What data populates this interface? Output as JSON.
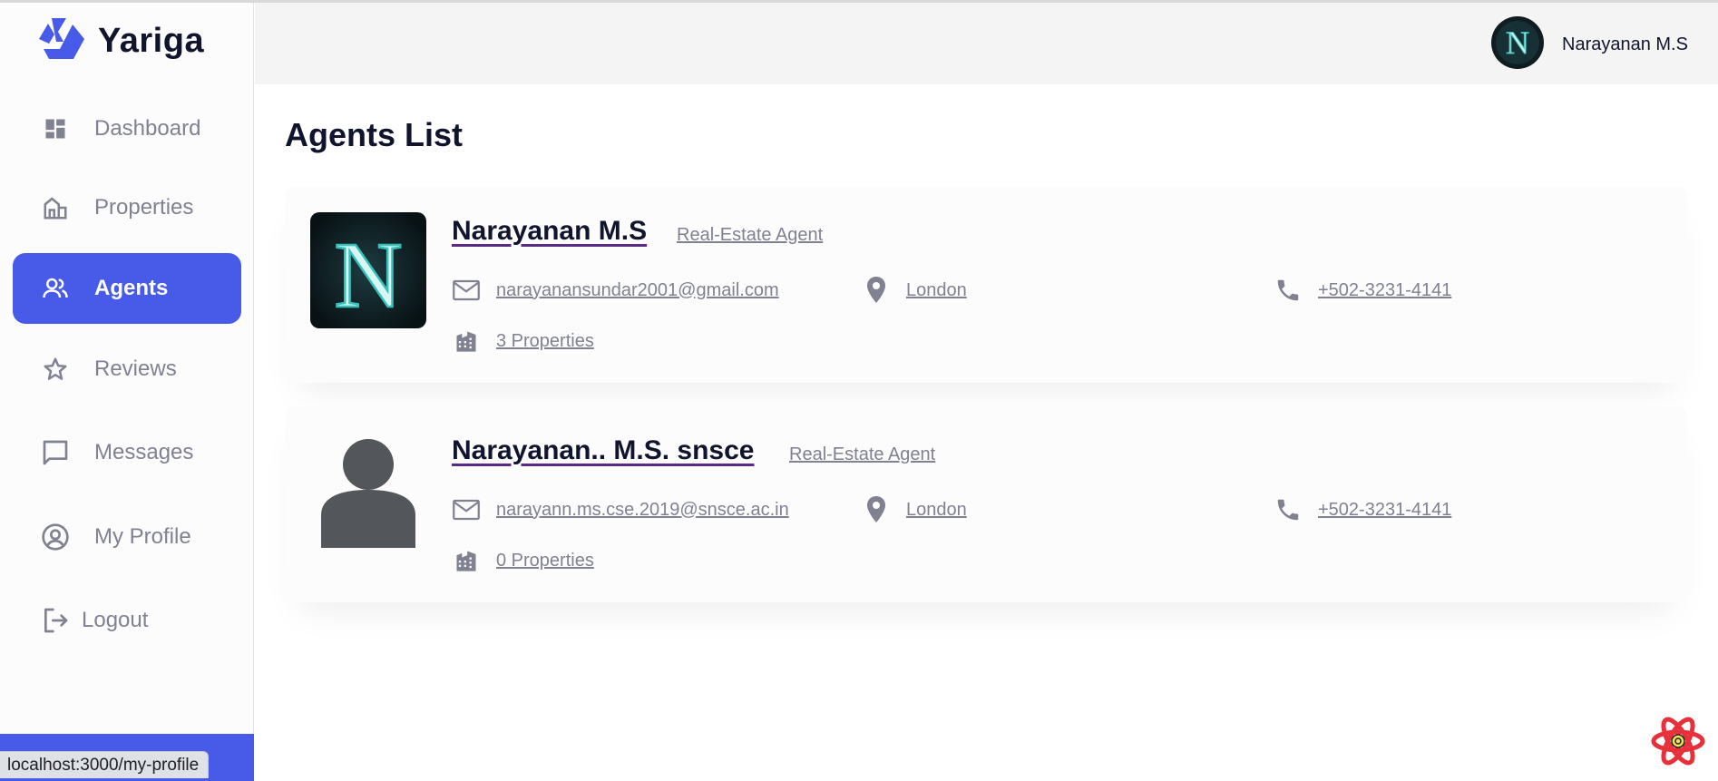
{
  "app": {
    "name": "Yariga"
  },
  "sidebar": {
    "items": [
      {
        "label": "Dashboard",
        "icon": "dashboard-icon"
      },
      {
        "label": "Properties",
        "icon": "properties-icon"
      },
      {
        "label": "Agents",
        "icon": "people-icon",
        "active": true
      },
      {
        "label": "Reviews",
        "icon": "star-icon"
      },
      {
        "label": "Messages",
        "icon": "chat-icon"
      },
      {
        "label": "My Profile",
        "icon": "account-circle-icon"
      }
    ],
    "logout_label": "Logout"
  },
  "header": {
    "user_name": "Narayanan M.S"
  },
  "main": {
    "title": "Agents List",
    "agents": [
      {
        "name": "Narayanan M.S",
        "role": "Real-Estate Agent",
        "email": "narayanansundar2001@gmail.com",
        "location": "London",
        "phone": "+502-3231-4141",
        "properties": "3 Properties",
        "avatar": "monogram-n"
      },
      {
        "name": "Narayanan.. M.S. snsce",
        "role": "Real-Estate Agent",
        "email": "narayann.ms.cse.2019@snsce.ac.in",
        "location": "London",
        "phone": "+502-3231-4141",
        "properties": "0 Properties",
        "avatar": "default-person"
      }
    ]
  },
  "status_bar": {
    "url": "localhost:3000/my-profile"
  },
  "colors": {
    "accent": "#475be8",
    "text_dark": "#11142d",
    "text_muted": "#808191",
    "header_bg": "#f4f4f4",
    "card_bg": "#fcfcfc"
  }
}
